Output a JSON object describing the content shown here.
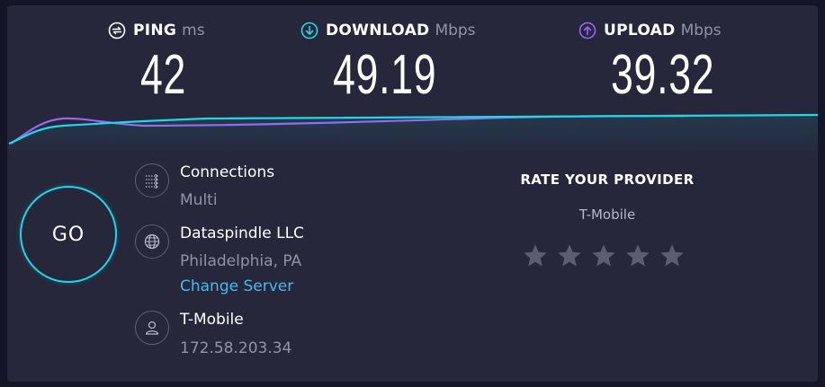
{
  "colors": {
    "background": "#141526",
    "panel": "#26273b",
    "download_accent": "#1fd8e7",
    "upload_accent": "#9b63f5",
    "link": "#4ab8ef",
    "muted_text": "#9193a8",
    "star": "#5c5e70"
  },
  "metrics": {
    "ping": {
      "label": "PING",
      "unit": "ms",
      "value": "42",
      "icon": "ping-icon"
    },
    "download": {
      "label": "DOWNLOAD",
      "unit": "Mbps",
      "value": "49.19",
      "icon": "download-arrow-icon"
    },
    "upload": {
      "label": "UPLOAD",
      "unit": "Mbps",
      "value": "39.32",
      "icon": "upload-arrow-icon"
    }
  },
  "go_button": {
    "label": "GO"
  },
  "connections": {
    "title": "Connections",
    "value": "Multi",
    "icon": "connections-icon"
  },
  "server": {
    "name": "Dataspindle LLC",
    "location": "Philadelphia, PA",
    "change_label": "Change Server",
    "icon": "globe-icon"
  },
  "provider": {
    "name": "T-Mobile",
    "ip": "172.58.203.34",
    "icon": "user-icon"
  },
  "rating": {
    "title": "RATE YOUR PROVIDER",
    "provider": "T-Mobile",
    "max_stars": 5,
    "selected": 0
  }
}
